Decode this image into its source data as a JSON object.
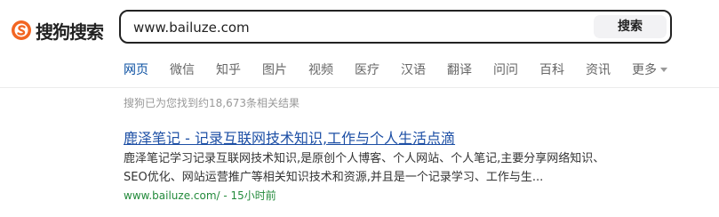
{
  "logo": {
    "text": "搜狗搜索"
  },
  "search": {
    "query": "www.bailuze.com",
    "button_label": "搜索"
  },
  "tabs": [
    {
      "label": "网页",
      "active": true
    },
    {
      "label": "微信"
    },
    {
      "label": "知乎"
    },
    {
      "label": "图片"
    },
    {
      "label": "视频"
    },
    {
      "label": "医疗"
    },
    {
      "label": "汉语"
    },
    {
      "label": "翻译"
    },
    {
      "label": "问问"
    },
    {
      "label": "百科"
    },
    {
      "label": "资讯"
    },
    {
      "label": "更多"
    }
  ],
  "results_info": {
    "count_text": "搜狗已为您找到约18,673条相关结果"
  },
  "result": {
    "title": "鹿泽笔记 - 记录互联网技术知识,工作与个人生活点滴",
    "snippet": "鹿泽笔记学习记录互联网技术知识,是原创个人博客、个人网站、个人笔记,主要分享网络知识、SEO优化、网站运营推广等相关知识技术和资源,并且是一个记录学习、工作与生...",
    "url": "www.bailuze.com/ - 15小时前"
  },
  "colors": {
    "logo_orange": "#f26522",
    "active_tab": "#0a4fa1",
    "link": "#1d4fa5",
    "url_green": "#238a3b"
  }
}
